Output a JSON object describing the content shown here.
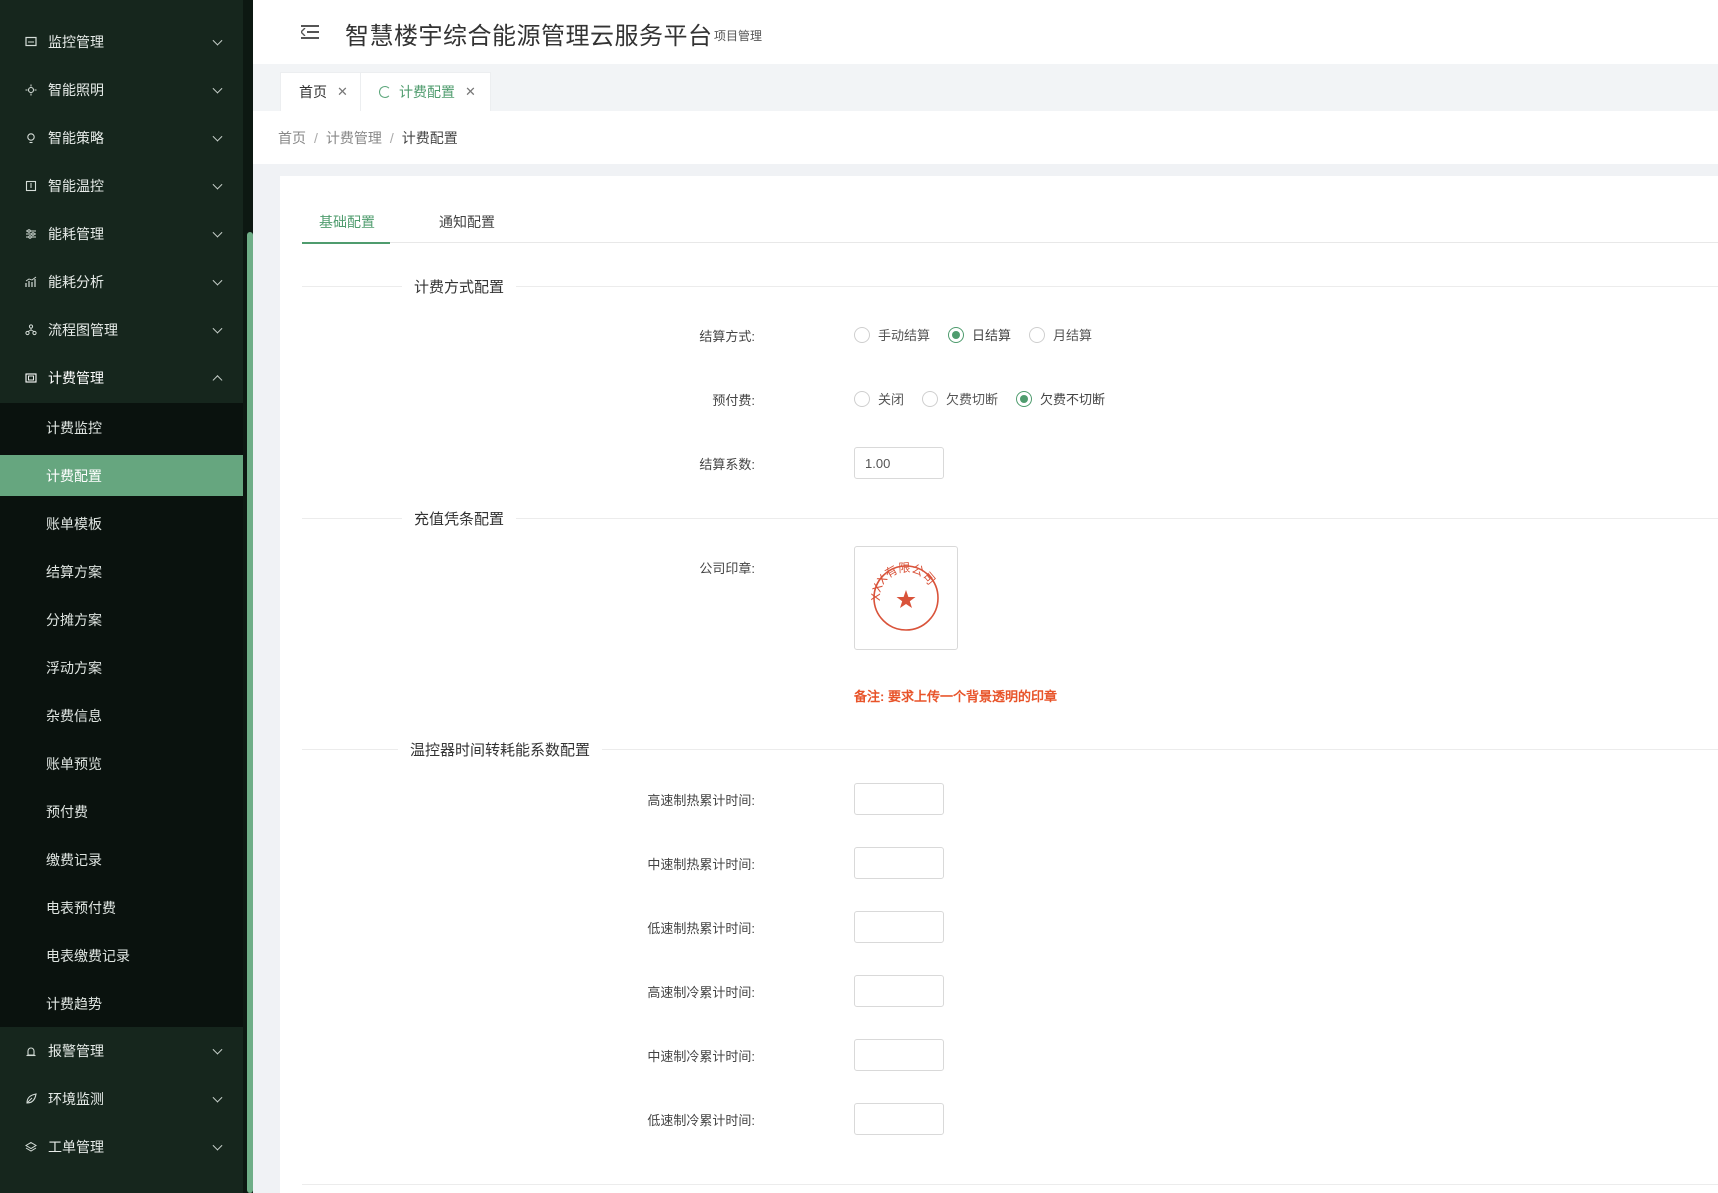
{
  "app": {
    "title": "智慧楼宇综合能源管理云服务平台",
    "subtitle": "项目管理"
  },
  "sidebar": {
    "menu": [
      {
        "label": "监控管理",
        "icon": "monitor-icon"
      },
      {
        "label": "智能照明",
        "icon": "sun-icon"
      },
      {
        "label": "智能策略",
        "icon": "bulb-icon"
      },
      {
        "label": "智能温控",
        "icon": "thermostat-icon"
      },
      {
        "label": "能耗管理",
        "icon": "sliders-icon"
      },
      {
        "label": "能耗分析",
        "icon": "analysis-icon"
      },
      {
        "label": "流程图管理",
        "icon": "flowchart-icon"
      },
      {
        "label": "计费管理",
        "icon": "billing-icon"
      }
    ],
    "billing_sub": [
      "计费监控",
      "计费配置",
      "账单模板",
      "结算方案",
      "分摊方案",
      "浮动方案",
      "杂费信息",
      "账单预览",
      "预付费",
      "缴费记录",
      "电表预付费",
      "电表缴费记录",
      "计费趋势"
    ],
    "active_sub": "计费配置",
    "menu_after": [
      {
        "label": "报警管理",
        "icon": "alarm-icon"
      },
      {
        "label": "环境监测",
        "icon": "leaf-icon"
      },
      {
        "label": "工单管理",
        "icon": "layers-icon"
      }
    ]
  },
  "tabs": [
    {
      "label": "首页"
    },
    {
      "label": "计费配置"
    }
  ],
  "breadcrumb": {
    "home": "首页",
    "parent": "计费管理",
    "current": "计费配置"
  },
  "content_tabs": {
    "basic": "基础配置",
    "notify": "通知配置"
  },
  "sections": {
    "billing_mode": "计费方式配置",
    "voucher": "充值凭条配置",
    "thermo": "温控器时间转耗能系数配置"
  },
  "form": {
    "settlement": {
      "label": "结算方式:",
      "options": [
        "手动结算",
        "日结算",
        "月结算"
      ],
      "selected": "日结算"
    },
    "prepaid": {
      "label": "预付费:",
      "options": [
        "关闭",
        "欠费切断",
        "欠费不切断"
      ],
      "selected": "欠费不切断"
    },
    "coefficient": {
      "label": "结算系数:",
      "value": "1.00"
    },
    "seal": {
      "label": "公司印章:",
      "seal_text": "XXX有限公司",
      "note": "备注: 要求上传一个背景透明的印章"
    },
    "thermo_fields": [
      {
        "label": "高速制热累计时间:",
        "value": ""
      },
      {
        "label": "中速制热累计时间:",
        "value": ""
      },
      {
        "label": "低速制热累计时间:",
        "value": ""
      },
      {
        "label": "高速制冷累计时间:",
        "value": ""
      },
      {
        "label": "中速制冷累计时间:",
        "value": ""
      },
      {
        "label": "低速制冷累计时间:",
        "value": ""
      }
    ]
  },
  "colors": {
    "sidebar_bg": "#16261d",
    "accent": "#4f9c6e",
    "active_item": "#66a67f",
    "note": "#e8542a",
    "seal": "#d9533a"
  }
}
